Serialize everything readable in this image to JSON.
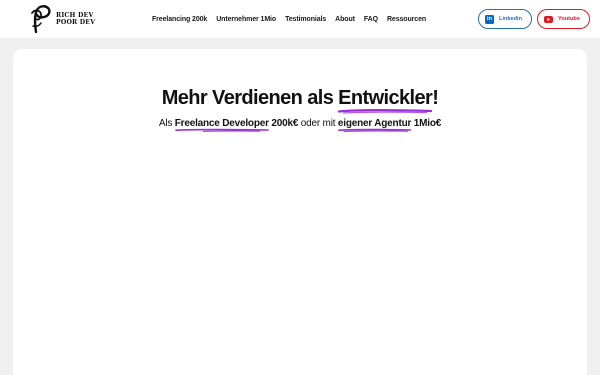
{
  "brand": {
    "line1": "RICH DEV",
    "line2": "POOR DEV",
    "icon": "logo-mark-icon"
  },
  "nav": {
    "items": [
      {
        "label": "Freelancing 200k"
      },
      {
        "label": "Unternehmer 1Mio"
      },
      {
        "label": "Testimonials"
      },
      {
        "label": "About"
      },
      {
        "label": "FAQ"
      },
      {
        "label": "Ressourcen"
      }
    ]
  },
  "social": {
    "linkedin": {
      "label": "Linkedin",
      "icon": "linkedin-icon",
      "color": "#2a6fb0"
    },
    "youtube": {
      "label": "Youtube",
      "icon": "youtube-icon",
      "color": "#e01b24"
    }
  },
  "hero": {
    "title_prefix": "Mehr Verdienen als ",
    "title_highlight": "Entwickler",
    "title_suffix": "!",
    "sub_prefix": "Als ",
    "sub_highlight1": "Freelance Developer",
    "sub_middle1": " 200k€",
    "sub_middle2": "  oder mit ",
    "sub_highlight2": "eigener Agentur",
    "sub_suffix": " 1Mio€",
    "accent_color": "#9b30d9"
  }
}
